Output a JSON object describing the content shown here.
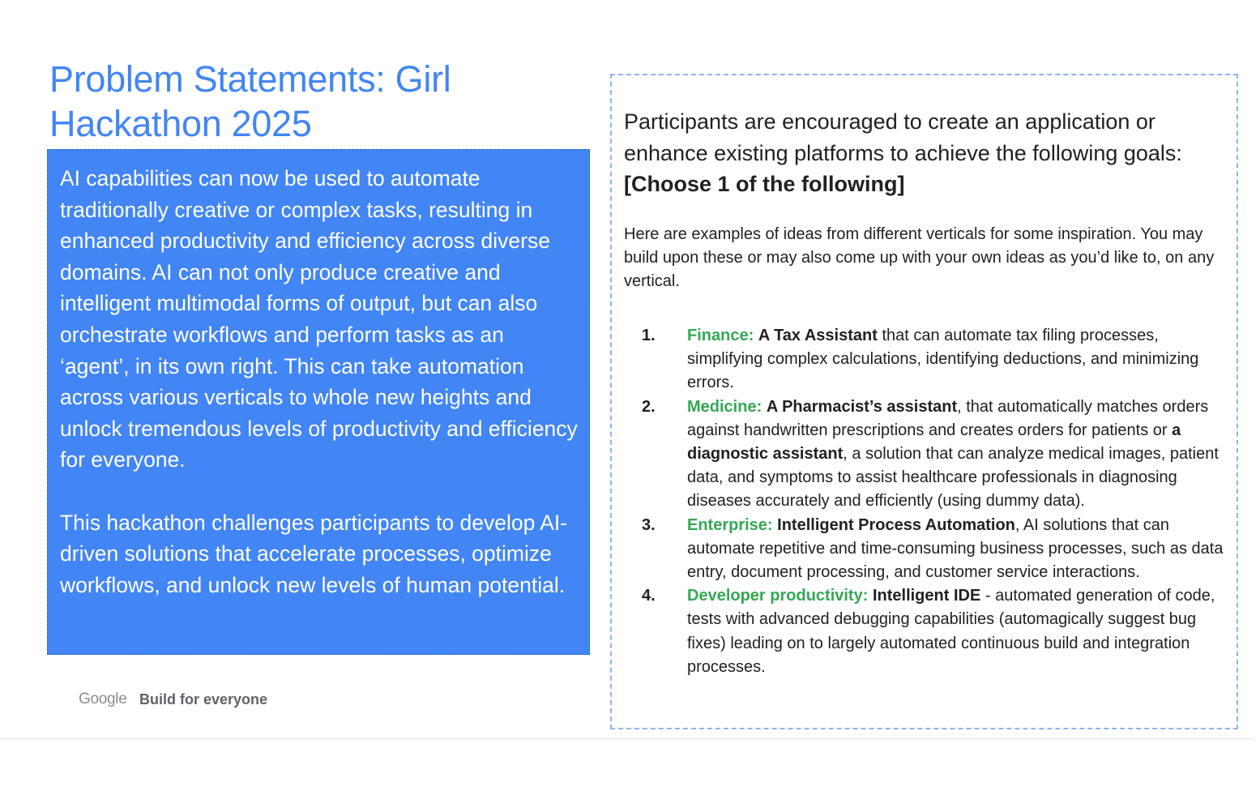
{
  "title": "Problem Statements: Girl Hackathon 2025",
  "intro": {
    "paragraph_1": "AI capabilities can now be used to automate traditionally creative or complex tasks, resulting in enhanced productivity and efficiency across diverse domains. AI can not only produce creative and intelligent multimodal forms of output, but can also orchestrate workflows and perform tasks as an ‘agent’, in its own right. This can take automation across various verticals to whole new heights and unlock tremendous levels of productivity and efficiency for everyone.",
    "paragraph_2": "This hackathon challenges participants to develop AI-driven solutions that accelerate processes, optimize workflows, and unlock new levels of human potential."
  },
  "footer": {
    "logo": "Google",
    "tagline": "Build for everyone"
  },
  "goals": {
    "lead": "Participants are encouraged to create an application or enhance existing platforms to achieve the following goals:",
    "choose": "[Choose 1 of the following]",
    "intro": "Here are examples of ideas from different verticals for some inspiration. You may build upon these or may also come up with your own ideas as you’d like to, on any vertical.",
    "items": [
      {
        "number": "1.",
        "category": "Finance:",
        "sep_1": " ",
        "bold_1": "A Tax Assistant",
        "text_1": " that can automate tax filing processes, simplifying complex calculations, identifying deductions, and minimizing errors.",
        "bold_2": "",
        "text_2": ""
      },
      {
        "number": "2.",
        "category": "Medicine:",
        "sep_1": " ",
        "bold_1": "A Pharmacist’s assistant",
        "text_1": ", that automatically matches orders against handwritten prescriptions and creates orders for patients or ",
        "bold_2": "a diagnostic assistant",
        "text_2": ", a solution that can analyze medical images, patient data, and symptoms to assist healthcare professionals in diagnosing diseases accurately and efficiently (using dummy data)."
      },
      {
        "number": "3.",
        "category": "Enterprise:",
        "sep_1": " ",
        "bold_1": "Intelligent Process Automation",
        "text_1": ", AI solutions that can automate repetitive and time-consuming business processes, such as data entry, document processing, and customer service interactions.",
        "bold_2": "",
        "text_2": ""
      },
      {
        "number": "4.",
        "category": "Developer productivity:",
        "sep_1": " ",
        "bold_1": "Intelligent IDE",
        "text_1": " - automated generation of code, tests with advanced debugging capabilities (automagically suggest bug fixes) leading on to largely automated continuous build and integration processes.",
        "bold_2": "",
        "text_2": ""
      }
    ]
  }
}
